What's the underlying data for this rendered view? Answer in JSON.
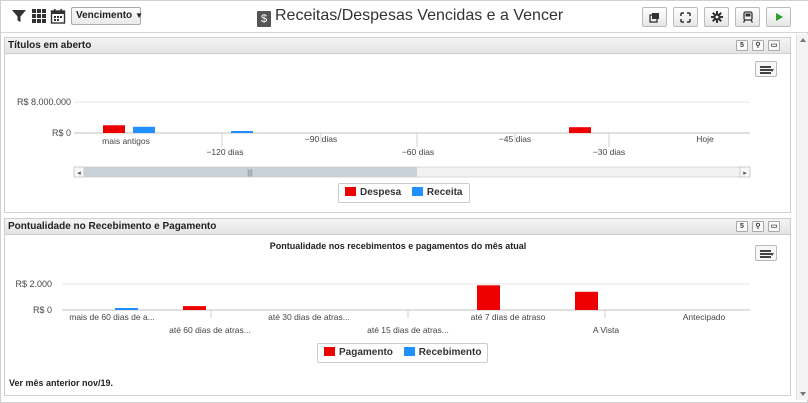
{
  "toolbar": {
    "filter_icon": "filter-icon",
    "grid_icon": "grid-icon",
    "calendar_icon": "calendar-icon",
    "select_value": "Vencimento",
    "title_icon": "dollar-icon",
    "title": "Receitas/Despesas Vencidas e a Vencer",
    "buttons": [
      "copy-icon",
      "fullscreen-icon",
      "gear-icon",
      "train-icon",
      "play-icon"
    ]
  },
  "panel1": {
    "title": "Títulos em aberto",
    "head_buttons": [
      "5",
      "zoom",
      "max"
    ],
    "chart_data": {
      "type": "bar",
      "y_tick_labels": [
        "R$ 8.000.000",
        "R$ 0"
      ],
      "categories": [
        "mais antigos",
        "−120 dias",
        "−90 dias",
        "−60 dias",
        "−45 dias",
        "−30 dias",
        "Hoje"
      ],
      "series": [
        {
          "name": "Despesa",
          "color": "#ee0000",
          "values": [
            2000000,
            0,
            0,
            0,
            0,
            1500000,
            0
          ]
        },
        {
          "name": "Receita",
          "color": "#1e90ff",
          "values": [
            1600000,
            300000,
            0,
            0,
            0,
            0,
            0
          ]
        }
      ],
      "ylim": [
        0,
        8000000
      ],
      "legend": "bottom-center"
    }
  },
  "panel2": {
    "title": "Pontualidade no Recebimento e Pagamento",
    "head_buttons": [
      "5",
      "zoom",
      "max"
    ],
    "chart_data": {
      "type": "bar",
      "title": "Pontualidade nos recebimentos e pagamentos do mês atual",
      "y_tick_labels": [
        "R$ 2.000",
        "R$ 0"
      ],
      "categories": [
        "mais de 60 dias de a...",
        "até 60 dias de atras...",
        "até 30 dias de atras...",
        "até 15 dias de atras...",
        "até 7 dias de atraso",
        "A Vista",
        "Antecipado"
      ],
      "series": [
        {
          "name": "Pagamento",
          "color": "#ee0000",
          "values": [
            0,
            300,
            0,
            0,
            1900,
            1400,
            0
          ]
        },
        {
          "name": "Recebimento",
          "color": "#1e90ff",
          "values": [
            150,
            0,
            0,
            0,
            0,
            0,
            0
          ]
        }
      ],
      "ylim": [
        0,
        2000
      ],
      "legend": "bottom-center"
    },
    "footer": "Ver mês anterior nov/19."
  }
}
